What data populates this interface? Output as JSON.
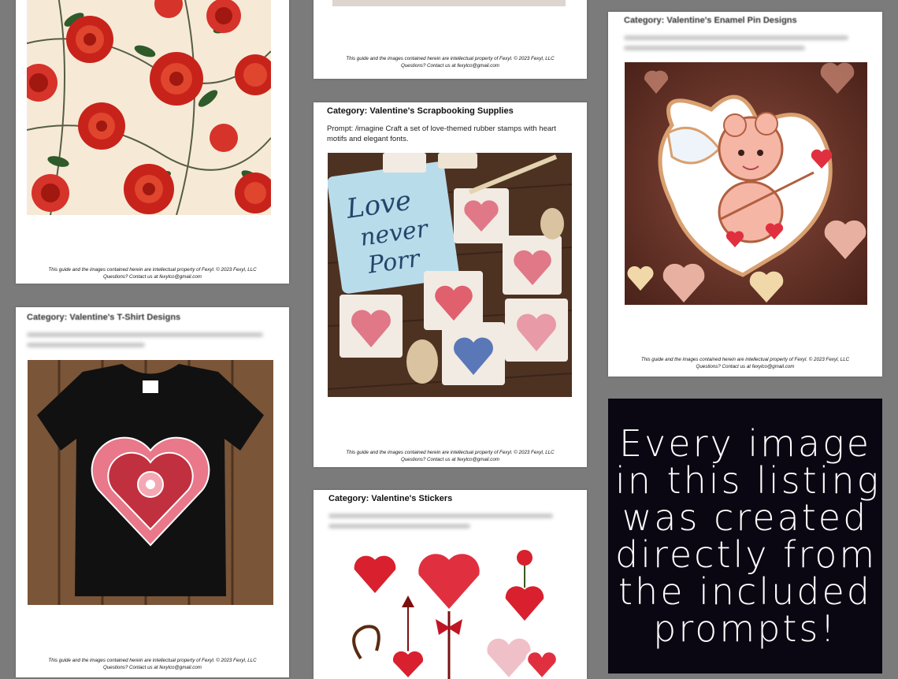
{
  "footer": {
    "line1": "This guide and the images contained herein are intellectual property of Fexyl. © 2023 Fexyl, LLC",
    "line2": "Questions? Contact us at fexylco@gmail.com"
  },
  "cards": {
    "roses": {
      "image_alt": "Seamless pattern of red roses with green leaves on a cream background"
    },
    "top_middle": {},
    "scrapbook": {
      "category": "Category: Valentine's Scrapbooking Supplies",
      "prompt": "Prompt: /imagine Craft a set of love-themed rubber stamps with heart motifs and elegant fonts.",
      "image_alt": "Love-themed rubber stamps with heart motifs and a blue stamp reading love",
      "stamp_text_1": "Love",
      "stamp_text_2": "never",
      "stamp_text_3": "Porr"
    },
    "enamel": {
      "category": "Category: Valentine's Enamel Pin Designs",
      "image_alt": "Cupid enamel pin with white wings and pink hearts"
    },
    "tshirt": {
      "category": "Category: Valentine's T-Shirt Designs",
      "image_alt": "Black t-shirt with a pink mandala heart design on wooden boards"
    },
    "stickers": {
      "category": "Category: Valentine's Stickers",
      "image_alt": "Red heart stickers with arrows and bows"
    }
  },
  "promo": {
    "lines": [
      "Every image",
      "in this listing",
      "was created",
      "directly from",
      "the included",
      "prompts!"
    ]
  },
  "colors": {
    "background": "#7b7b7b",
    "promo_background": "#0a0612",
    "rose_red": "#c8231b",
    "heart_pink": "#e8788a"
  }
}
